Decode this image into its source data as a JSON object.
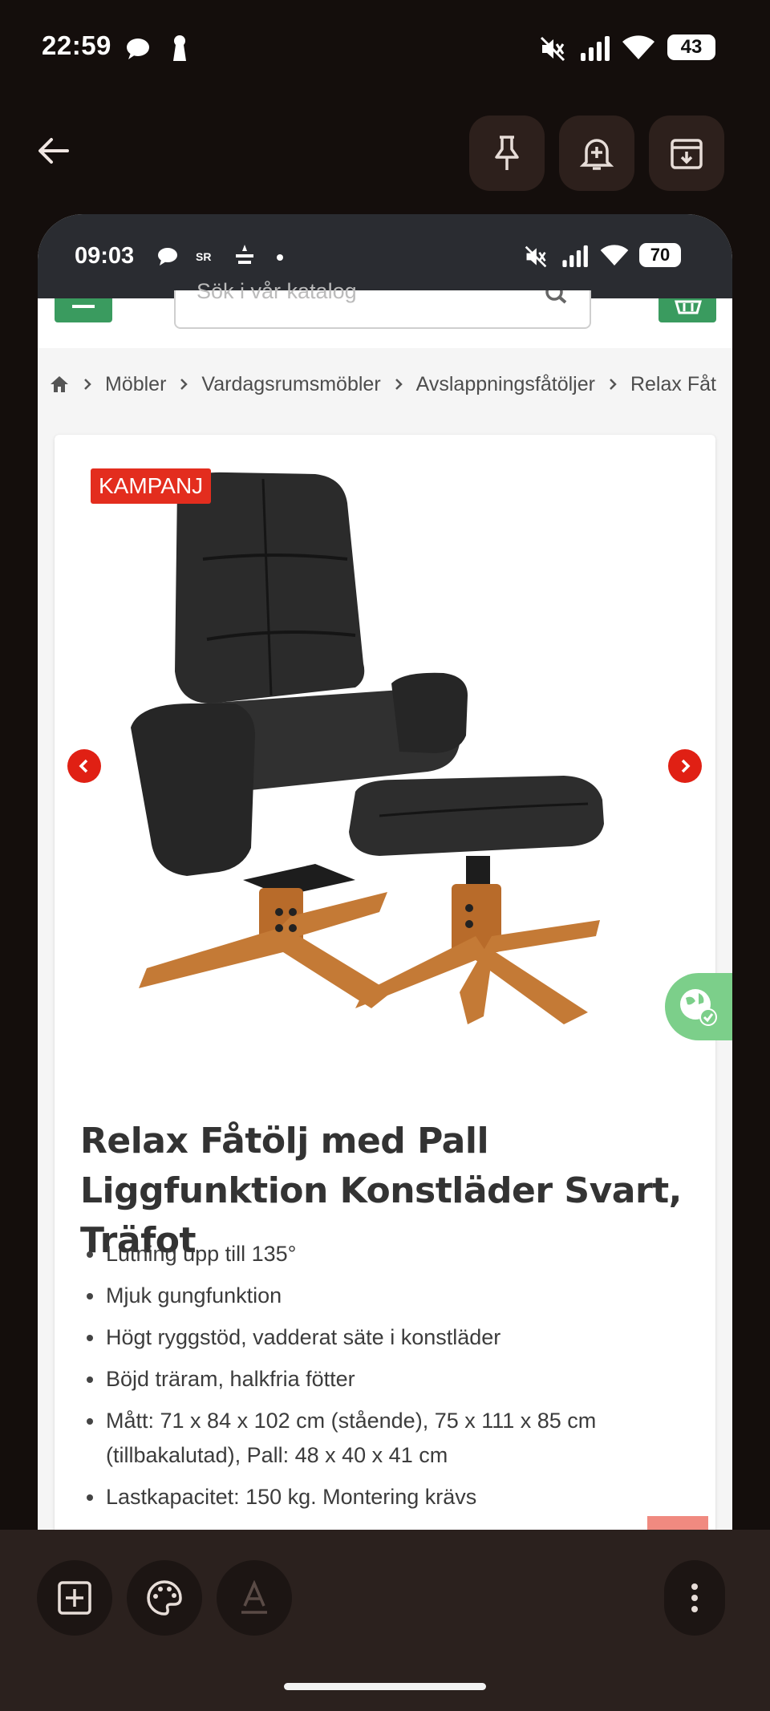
{
  "status_bar": {
    "time": "22:59",
    "battery": "43"
  },
  "toolbar": {
    "back_icon": "arrow-left-icon",
    "pin_icon": "pin-icon",
    "reminder_icon": "bell-plus-icon",
    "archive_icon": "archive-icon"
  },
  "screenshot": {
    "status_bar": {
      "time": "09:03",
      "battery": "70"
    },
    "header": {
      "search_placeholder": "Sök i vår katalog"
    },
    "breadcrumbs": [
      "Möbler",
      "Vardagsrumsmöbler",
      "Avslappningsfåtöljer",
      "Relax Fåt"
    ],
    "product": {
      "badge": "KAMPANJ",
      "title": "Relax Fåtölj med Pall Liggfunktion Konstläder Svart, Träfot",
      "features": [
        "Lutning upp till 135°",
        "Mjuk gungfunktion",
        "Högt ryggstöd, vadderat säte i konstläder",
        "Böjd träram, halkfria fötter",
        "Mått: 71 x 84 x 102 cm (stående), 75 x 111 x 85 cm (tillbakalutad), Pall: 48 x 40 x 41 cm",
        "Lastkapacitet: 150 kg. Montering krävs"
      ]
    },
    "colors": {
      "accent_green": "#3a9b5f",
      "badge_red": "#e32d1e"
    }
  },
  "bottom_toolbar": {
    "add_icon": "add-box-icon",
    "palette_icon": "palette-icon",
    "text_format_icon": "text-format-icon",
    "more_icon": "more-vert-icon"
  }
}
